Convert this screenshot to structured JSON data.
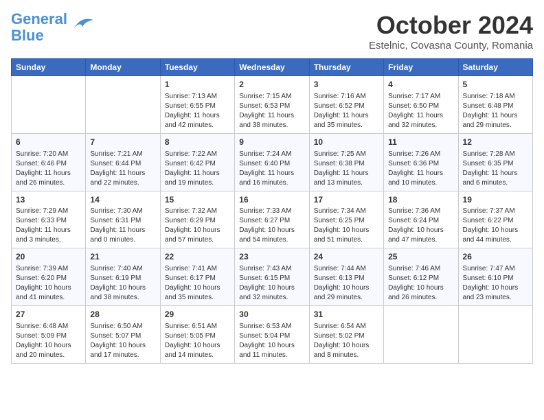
{
  "header": {
    "logo_line1": "General",
    "logo_line2": "Blue",
    "month": "October 2024",
    "location": "Estelnic, Covasna County, Romania"
  },
  "days_of_week": [
    "Sunday",
    "Monday",
    "Tuesday",
    "Wednesday",
    "Thursday",
    "Friday",
    "Saturday"
  ],
  "weeks": [
    [
      {
        "day": "",
        "info": ""
      },
      {
        "day": "",
        "info": ""
      },
      {
        "day": "1",
        "info": "Sunrise: 7:13 AM\nSunset: 6:55 PM\nDaylight: 11 hours and 42 minutes."
      },
      {
        "day": "2",
        "info": "Sunrise: 7:15 AM\nSunset: 6:53 PM\nDaylight: 11 hours and 38 minutes."
      },
      {
        "day": "3",
        "info": "Sunrise: 7:16 AM\nSunset: 6:52 PM\nDaylight: 11 hours and 35 minutes."
      },
      {
        "day": "4",
        "info": "Sunrise: 7:17 AM\nSunset: 6:50 PM\nDaylight: 11 hours and 32 minutes."
      },
      {
        "day": "5",
        "info": "Sunrise: 7:18 AM\nSunset: 6:48 PM\nDaylight: 11 hours and 29 minutes."
      }
    ],
    [
      {
        "day": "6",
        "info": "Sunrise: 7:20 AM\nSunset: 6:46 PM\nDaylight: 11 hours and 26 minutes."
      },
      {
        "day": "7",
        "info": "Sunrise: 7:21 AM\nSunset: 6:44 PM\nDaylight: 11 hours and 22 minutes."
      },
      {
        "day": "8",
        "info": "Sunrise: 7:22 AM\nSunset: 6:42 PM\nDaylight: 11 hours and 19 minutes."
      },
      {
        "day": "9",
        "info": "Sunrise: 7:24 AM\nSunset: 6:40 PM\nDaylight: 11 hours and 16 minutes."
      },
      {
        "day": "10",
        "info": "Sunrise: 7:25 AM\nSunset: 6:38 PM\nDaylight: 11 hours and 13 minutes."
      },
      {
        "day": "11",
        "info": "Sunrise: 7:26 AM\nSunset: 6:36 PM\nDaylight: 11 hours and 10 minutes."
      },
      {
        "day": "12",
        "info": "Sunrise: 7:28 AM\nSunset: 6:35 PM\nDaylight: 11 hours and 6 minutes."
      }
    ],
    [
      {
        "day": "13",
        "info": "Sunrise: 7:29 AM\nSunset: 6:33 PM\nDaylight: 11 hours and 3 minutes."
      },
      {
        "day": "14",
        "info": "Sunrise: 7:30 AM\nSunset: 6:31 PM\nDaylight: 11 hours and 0 minutes."
      },
      {
        "day": "15",
        "info": "Sunrise: 7:32 AM\nSunset: 6:29 PM\nDaylight: 10 hours and 57 minutes."
      },
      {
        "day": "16",
        "info": "Sunrise: 7:33 AM\nSunset: 6:27 PM\nDaylight: 10 hours and 54 minutes."
      },
      {
        "day": "17",
        "info": "Sunrise: 7:34 AM\nSunset: 6:25 PM\nDaylight: 10 hours and 51 minutes."
      },
      {
        "day": "18",
        "info": "Sunrise: 7:36 AM\nSunset: 6:24 PM\nDaylight: 10 hours and 47 minutes."
      },
      {
        "day": "19",
        "info": "Sunrise: 7:37 AM\nSunset: 6:22 PM\nDaylight: 10 hours and 44 minutes."
      }
    ],
    [
      {
        "day": "20",
        "info": "Sunrise: 7:39 AM\nSunset: 6:20 PM\nDaylight: 10 hours and 41 minutes."
      },
      {
        "day": "21",
        "info": "Sunrise: 7:40 AM\nSunset: 6:19 PM\nDaylight: 10 hours and 38 minutes."
      },
      {
        "day": "22",
        "info": "Sunrise: 7:41 AM\nSunset: 6:17 PM\nDaylight: 10 hours and 35 minutes."
      },
      {
        "day": "23",
        "info": "Sunrise: 7:43 AM\nSunset: 6:15 PM\nDaylight: 10 hours and 32 minutes."
      },
      {
        "day": "24",
        "info": "Sunrise: 7:44 AM\nSunset: 6:13 PM\nDaylight: 10 hours and 29 minutes."
      },
      {
        "day": "25",
        "info": "Sunrise: 7:46 AM\nSunset: 6:12 PM\nDaylight: 10 hours and 26 minutes."
      },
      {
        "day": "26",
        "info": "Sunrise: 7:47 AM\nSunset: 6:10 PM\nDaylight: 10 hours and 23 minutes."
      }
    ],
    [
      {
        "day": "27",
        "info": "Sunrise: 6:48 AM\nSunset: 5:09 PM\nDaylight: 10 hours and 20 minutes."
      },
      {
        "day": "28",
        "info": "Sunrise: 6:50 AM\nSunset: 5:07 PM\nDaylight: 10 hours and 17 minutes."
      },
      {
        "day": "29",
        "info": "Sunrise: 6:51 AM\nSunset: 5:05 PM\nDaylight: 10 hours and 14 minutes."
      },
      {
        "day": "30",
        "info": "Sunrise: 6:53 AM\nSunset: 5:04 PM\nDaylight: 10 hours and 11 minutes."
      },
      {
        "day": "31",
        "info": "Sunrise: 6:54 AM\nSunset: 5:02 PM\nDaylight: 10 hours and 8 minutes."
      },
      {
        "day": "",
        "info": ""
      },
      {
        "day": "",
        "info": ""
      }
    ]
  ]
}
